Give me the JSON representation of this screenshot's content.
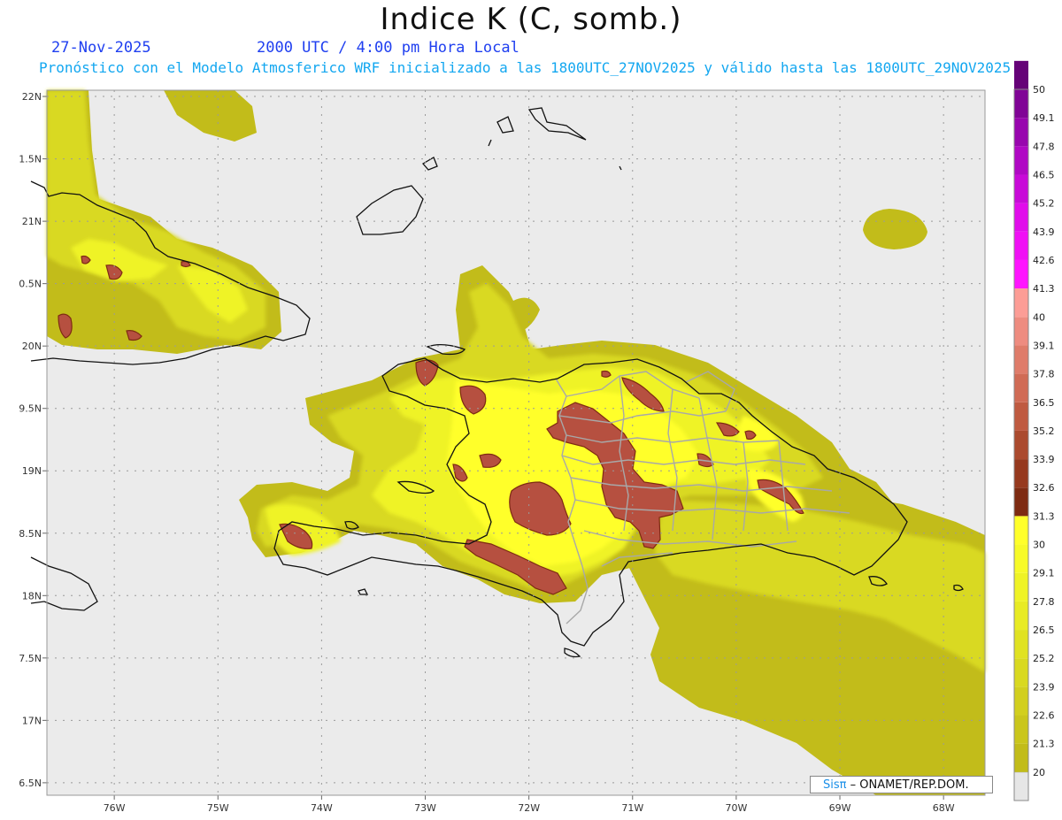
{
  "header": {
    "title": "Indice K (C, somb.)",
    "date": "27-Nov-2025",
    "utc_time": "2000 UTC / 4:00 pm Hora Local",
    "subtitle": "Pronóstico con el Modelo Atmosferico WRF inicializado a las 1800UTC_27NOV2025 y válido hasta las  1800UTC_29NOV2025"
  },
  "map": {
    "lon_range": [
      -76.65,
      -67.6
    ],
    "lat_range": [
      16.4,
      22.05
    ],
    "lat_ticks": [
      {
        "value": 22.0,
        "label": "22N"
      },
      {
        "value": 21.5,
        "label": "1.5N"
      },
      {
        "value": 21.0,
        "label": "21N"
      },
      {
        "value": 20.5,
        "label": "0.5N"
      },
      {
        "value": 20.0,
        "label": "20N"
      },
      {
        "value": 19.5,
        "label": "9.5N"
      },
      {
        "value": 19.0,
        "label": "19N"
      },
      {
        "value": 18.5,
        "label": "8.5N"
      },
      {
        "value": 18.0,
        "label": "18N"
      },
      {
        "value": 17.5,
        "label": "7.5N"
      },
      {
        "value": 17.0,
        "label": "17N"
      },
      {
        "value": 16.5,
        "label": "6.5N"
      }
    ],
    "lon_ticks": [
      {
        "value": -76,
        "label": "76W"
      },
      {
        "value": -75,
        "label": "75W"
      },
      {
        "value": -74,
        "label": "74W"
      },
      {
        "value": -73,
        "label": "73W"
      },
      {
        "value": -72,
        "label": "72W"
      },
      {
        "value": -71,
        "label": "71W"
      },
      {
        "value": -70,
        "label": "70W"
      },
      {
        "value": -69,
        "label": "69W"
      },
      {
        "value": -68,
        "label": "68W"
      }
    ],
    "background_color": "#ebebeb"
  },
  "colorbar": {
    "levels": [
      {
        "label": "20",
        "color": "#c2bc1a"
      },
      {
        "label": "21.3",
        "color": "#cac61c"
      },
      {
        "label": "22.6",
        "color": "#d2cf1e"
      },
      {
        "label": "23.9",
        "color": "#d9d920"
      },
      {
        "label": "25.2",
        "color": "#e0e222"
      },
      {
        "label": "26.5",
        "color": "#e8eb24"
      },
      {
        "label": "27.8",
        "color": "#eff326"
      },
      {
        "label": "29.1",
        "color": "#f7fa28"
      },
      {
        "label": "30",
        "color": "#ffff2a"
      },
      {
        "label": "31.3",
        "color": "#7e2b12"
      },
      {
        "label": "32.6",
        "color": "#96391e"
      },
      {
        "label": "33.9",
        "color": "#ab4a2e"
      },
      {
        "label": "35.2",
        "color": "#bf5a40"
      },
      {
        "label": "36.5",
        "color": "#d06b55"
      },
      {
        "label": "37.8",
        "color": "#df7c6a"
      },
      {
        "label": "39.1",
        "color": "#ee8c80"
      },
      {
        "label": "40",
        "color": "#fc9d96"
      },
      {
        "label": "41.3",
        "color": "#ff14ff"
      },
      {
        "label": "42.6",
        "color": "#f010f5"
      },
      {
        "label": "43.9",
        "color": "#e10ceb"
      },
      {
        "label": "45.2",
        "color": "#c80ad8"
      },
      {
        "label": "46.5",
        "color": "#b008c4"
      },
      {
        "label": "47.8",
        "color": "#9806ae"
      },
      {
        "label": "49.1",
        "color": "#800496"
      },
      {
        "label": "50",
        "color": "#660278"
      }
    ]
  },
  "credit": {
    "sis": "Sisπ",
    "rest": "– ONAMET/REP.DOM."
  }
}
